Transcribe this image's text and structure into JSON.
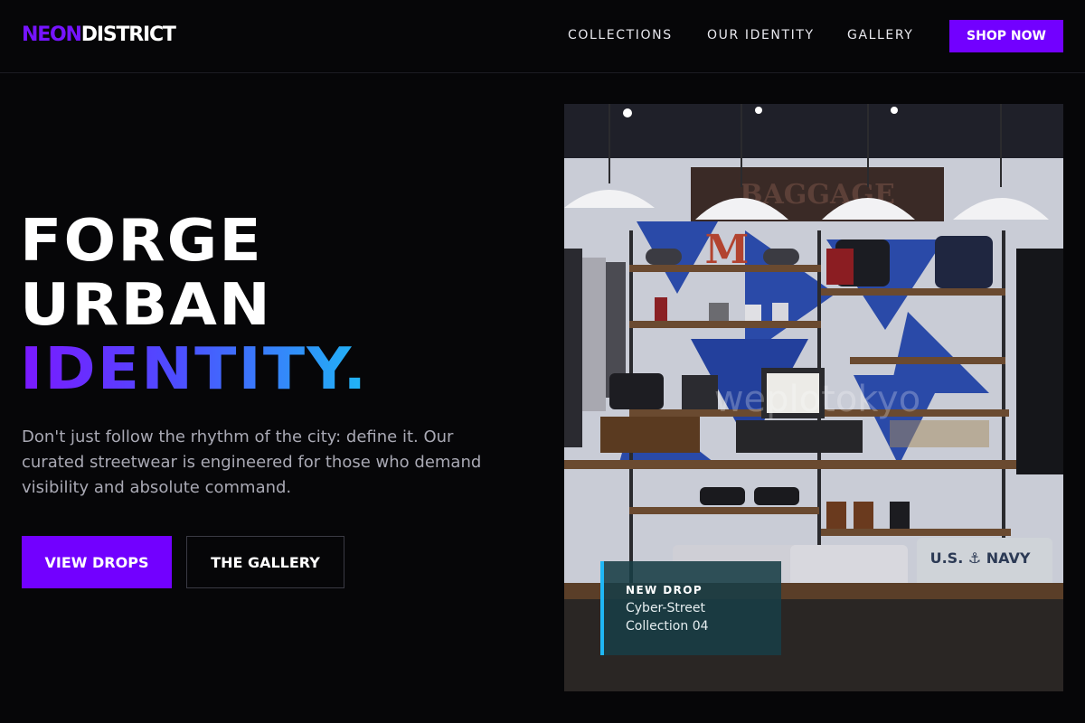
{
  "brand": {
    "part1": "NEON",
    "part2": "DISTRICT",
    "accent": "#7614ff"
  },
  "nav": {
    "items": [
      {
        "label": "COLLECTIONS"
      },
      {
        "label": "OUR IDENTITY"
      },
      {
        "label": "GALLERY"
      }
    ],
    "cta": "SHOP NOW"
  },
  "hero": {
    "line1": "FORGE",
    "line2": "URBAN",
    "line3": "IDENTITY.",
    "subcopy": "Don't just follow the rhythm of the city: define it. Our curated streetwear is engineered for those who demand visibility and absolute command.",
    "primary_button": "VIEW DROPS",
    "secondary_button": "THE GALLERY"
  },
  "image": {
    "alt": "Streetwear store interior",
    "watermark": "weplotokyo",
    "sign": "BAGGAGE",
    "sweatshirt_text": "U.S. ⚓ NAVY",
    "letter": "M"
  },
  "feature_card": {
    "kicker": "NEW DROP",
    "title": "Cyber-Street Collection 04"
  },
  "colors": {
    "primary": "#7200ff",
    "gradient_start": "#7b18ff",
    "gradient_end": "#1fb7f5",
    "background": "#060608"
  }
}
